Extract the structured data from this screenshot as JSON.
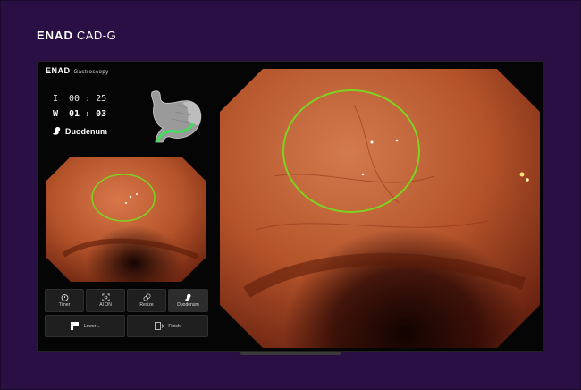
{
  "brand": {
    "logo": "ENAD",
    "product": "CAD-G"
  },
  "screen": {
    "logo": "ENAD",
    "mode": "Gastroscopy",
    "timers": [
      {
        "key": "I",
        "value": "00 : 25"
      },
      {
        "key": "W",
        "value": "01 : 03"
      }
    ],
    "location": "Duodenum"
  },
  "controls": {
    "timer": "Timer",
    "ai": "AI ON",
    "resize": "Resize",
    "duodenum": "Duodenum",
    "lower": "Lower→",
    "finish": "Finish"
  },
  "colors": {
    "background": "#2a0f44",
    "detection": "#7ed321",
    "tissue": "#b4532a"
  },
  "icons": [
    "stomach-diagram-icon",
    "timer-icon",
    "ai-scan-icon",
    "resize-icon",
    "duodenum-icon",
    "lower-icon",
    "finish-icon"
  ]
}
